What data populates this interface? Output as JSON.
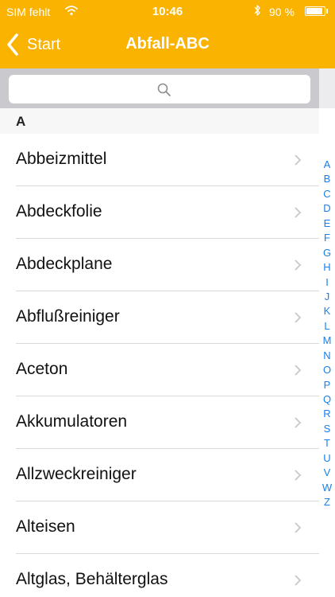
{
  "status_bar": {
    "carrier": "SIM fehlt",
    "time": "10:46",
    "battery_percent": "90 %",
    "battery_level": 0.9,
    "icons": [
      "wifi-icon",
      "bluetooth-icon",
      "battery-icon"
    ]
  },
  "nav": {
    "back_label": "Start",
    "title": "Abfall-ABC",
    "accent_color": "#f9b300"
  },
  "search": {
    "placeholder": ""
  },
  "section": {
    "header": "A"
  },
  "items": [
    "Abbeizmittel",
    "Abdeckfolie",
    "Abdeckplane",
    "Abflußreiniger",
    "Aceton",
    "Akkumulatoren",
    "Allzweckreiniger",
    "Alteisen",
    "Altglas, Behälterglas"
  ],
  "index_letters": [
    "A",
    "B",
    "C",
    "D",
    "E",
    "F",
    "G",
    "H",
    "I",
    "J",
    "K",
    "L",
    "M",
    "N",
    "O",
    "P",
    "Q",
    "R",
    "S",
    "T",
    "U",
    "V",
    "W",
    "Z"
  ],
  "colors": {
    "index": "#1a7fe8",
    "chevron": "#c7c7cc"
  }
}
